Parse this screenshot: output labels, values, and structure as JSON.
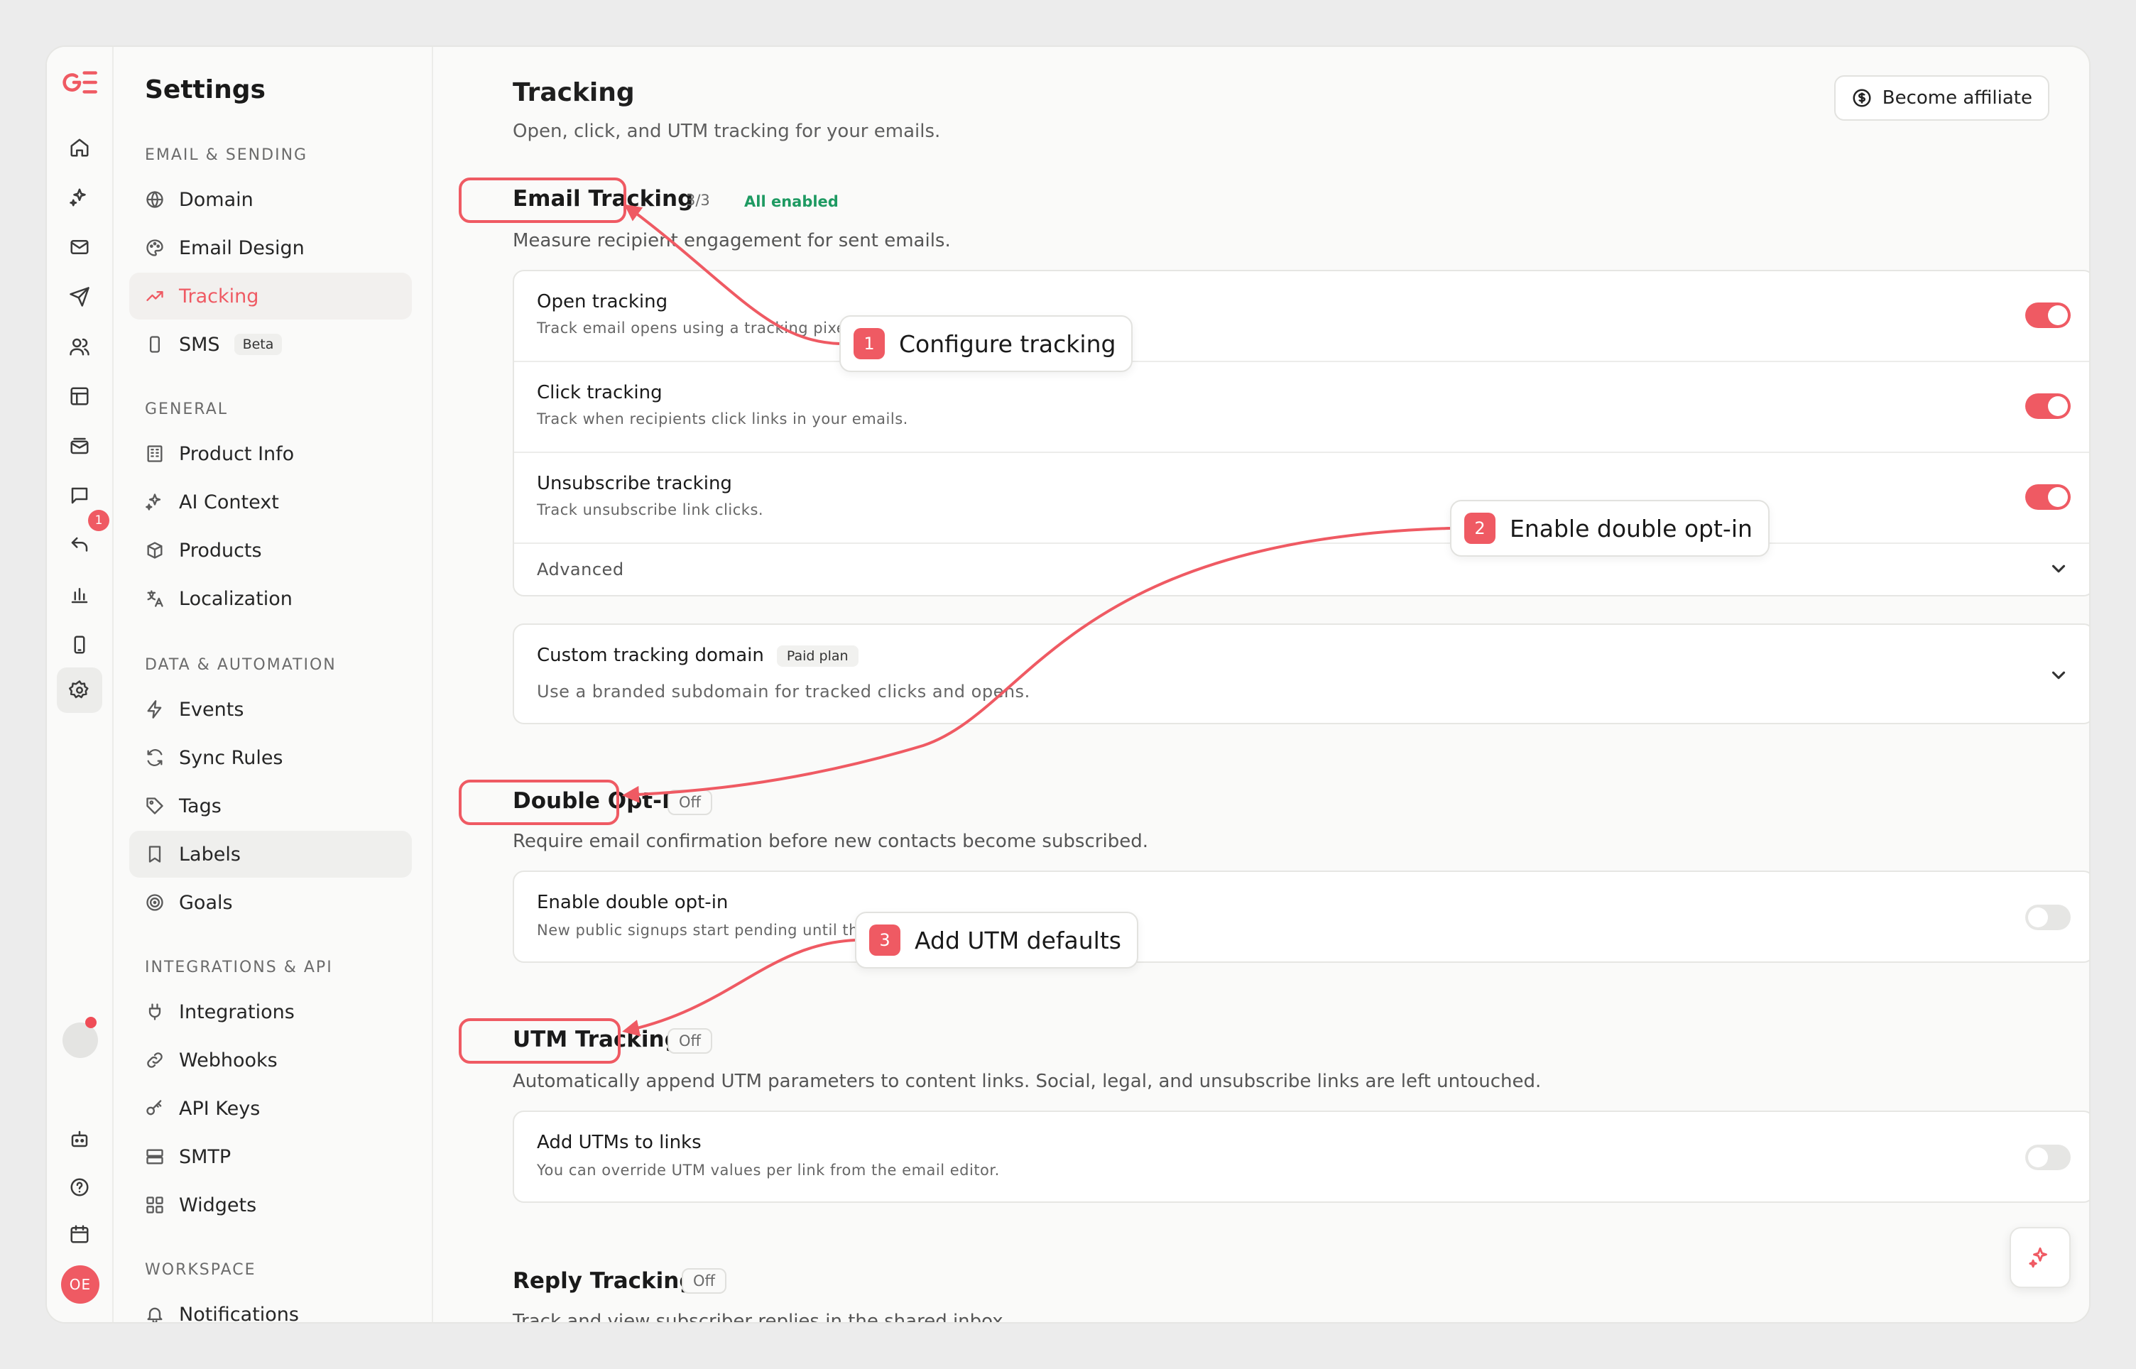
{
  "rail": {
    "badge_count": "1",
    "avatar_initials": "OE"
  },
  "sidebar": {
    "title": "Settings",
    "sections": {
      "email_sending": "EMAIL & SENDING",
      "general": "GENERAL",
      "data_automation": "DATA & AUTOMATION",
      "integrations_api": "INTEGRATIONS & API",
      "workspace": "WORKSPACE"
    },
    "items": {
      "domain": "Domain",
      "email_design": "Email Design",
      "tracking": "Tracking",
      "sms": "SMS",
      "sms_badge": "Beta",
      "product_info": "Product Info",
      "ai_context": "AI Context",
      "products": "Products",
      "localization": "Localization",
      "events": "Events",
      "sync_rules": "Sync Rules",
      "tags": "Tags",
      "labels": "Labels",
      "goals": "Goals",
      "integrations": "Integrations",
      "webhooks": "Webhooks",
      "api_keys": "API Keys",
      "smtp": "SMTP",
      "widgets": "Widgets",
      "notifications": "Notifications"
    }
  },
  "header": {
    "title": "Tracking",
    "subtitle": "Open, click, and UTM tracking for your emails.",
    "affiliate_label": "Become affiliate"
  },
  "email_tracking": {
    "title": "Email Tracking",
    "count": "3/3",
    "status": "All enabled",
    "description": "Measure recipient engagement for sent emails.",
    "rows": [
      {
        "title": "Open tracking",
        "desc": "Track email opens using a tracking pixel.",
        "enabled": true
      },
      {
        "title": "Click tracking",
        "desc": "Track when recipients click links in your emails.",
        "enabled": true
      },
      {
        "title": "Unsubscribe tracking",
        "desc": "Track unsubscribe link clicks.",
        "enabled": true
      }
    ],
    "advanced_label": "Advanced"
  },
  "custom_domain": {
    "title": "Custom tracking domain",
    "badge": "Paid plan",
    "desc": "Use a branded subdomain for tracked clicks and opens."
  },
  "double_optin": {
    "title": "Double Opt-In",
    "badge": "Off",
    "description": "Require email confirmation before new contacts become subscribed.",
    "row_title": "Enable double opt-in",
    "row_desc": "New public signups start pending until they confirm",
    "enabled": false
  },
  "utm": {
    "title": "UTM Tracking",
    "badge": "Off",
    "description": "Automatically append UTM parameters to content links. Social, legal, and unsubscribe links are left untouched.",
    "row_title": "Add UTMs to links",
    "row_desc": "You can override UTM values per link from the email editor.",
    "enabled": false
  },
  "reply_tracking": {
    "title": "Reply Tracking",
    "badge": "Off",
    "description": "Track and view subscriber replies in the shared inbox."
  },
  "callouts": [
    {
      "num": "1",
      "text": "Configure tracking"
    },
    {
      "num": "2",
      "text": "Enable double opt-in"
    },
    {
      "num": "3",
      "text": "Add UTM defaults"
    }
  ],
  "colors": {
    "accent": "#ef5a63",
    "success": "#1e9a62"
  }
}
